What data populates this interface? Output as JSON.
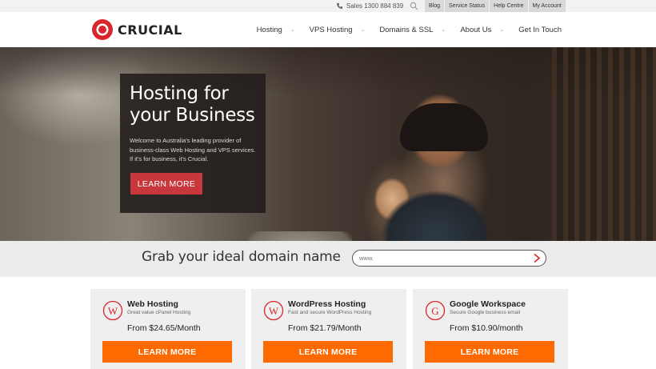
{
  "utility": {
    "sales": "Sales 1300 884 839",
    "links": [
      "Blog",
      "Service Status",
      "Help Centre",
      "My Account"
    ]
  },
  "brand": {
    "name": "CRUCIAL",
    "color": "#d9262c"
  },
  "nav": {
    "items": [
      {
        "label": "Hosting",
        "has_dropdown": true
      },
      {
        "label": "VPS Hosting",
        "has_dropdown": true
      },
      {
        "label": "Domains & SSL",
        "has_dropdown": true
      },
      {
        "label": "About Us",
        "has_dropdown": true
      },
      {
        "label": "Get In Touch",
        "has_dropdown": false
      }
    ]
  },
  "hero": {
    "title_line1": "Hosting for",
    "title_line2": "your Business",
    "description": "Welcome to Australia's leading provider of business-class Web Hosting and VPS services. If it's for business, it's Crucial.",
    "button": "LEARN MORE",
    "button_color": "#c8373b"
  },
  "domain_search": {
    "heading": "Grab your ideal domain name",
    "placeholder": "www."
  },
  "products": [
    {
      "icon": "wordpress-icon",
      "letter": "W",
      "title": "Web Hosting",
      "subtitle": "Great value cPanel Hosting",
      "price": "From $24.65/Month",
      "button": "LEARN MORE"
    },
    {
      "icon": "wordpress-icon",
      "letter": "W",
      "title": "WordPress Hosting",
      "subtitle": "Fast and secure WordPress Hosting",
      "price": "From $21.79/Month",
      "button": "LEARN MORE"
    },
    {
      "icon": "google-icon",
      "letter": "G",
      "title": "Google Workspace",
      "subtitle": "Secure Google business email",
      "price": "From $10.90/month",
      "button": "LEARN MORE"
    }
  ],
  "colors": {
    "accent": "#ff6a00",
    "icon_red": "#d9262c"
  }
}
